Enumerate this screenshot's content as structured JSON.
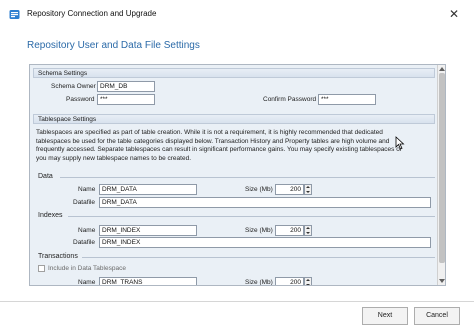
{
  "window": {
    "title": "Repository Connection and Upgrade",
    "close_glyph": "✕"
  },
  "heading": "Repository User and Data File Settings",
  "schema": {
    "section_title": "Schema Settings",
    "owner_label": "Schema Owner",
    "owner_value": "DRM_DB",
    "password_label": "Password",
    "password_value": "***",
    "confirm_label": "Confirm Password",
    "confirm_value": "***"
  },
  "tablespace": {
    "section_title": "Tablespace Settings",
    "description": "Tablespaces are specified as part of table creation. While it is not a requirement, it is highly recommended that dedicated tablespaces be used for the table categories displayed below. Transaction History and Property tables are high volume and frequently accessed. Separate tablespaces can result in significant performance gains. You may specify existing tablespaces or you may supply new tablespace names to be created."
  },
  "data": {
    "title": "Data",
    "name_label": "Name",
    "name_value": "DRM_DATA",
    "size_label": "Size (Mb)",
    "size_value": "200",
    "datafile_label": "Datafile",
    "datafile_value": "DRM_DATA"
  },
  "indexes": {
    "title": "Indexes",
    "name_label": "Name",
    "name_value": "DRM_INDEX",
    "size_label": "Size (Mb)",
    "size_value": "200",
    "datafile_label": "Datafile",
    "datafile_value": "DRM_INDEX"
  },
  "transactions": {
    "title": "Transactions",
    "include_label": "Include in Data Tablespace",
    "name_label": "Name",
    "name_value": "DRM_TRANS",
    "size_label": "Size (Mb)",
    "size_value": "200"
  },
  "footer": {
    "next_label": "Next",
    "cancel_label": "Cancel"
  },
  "colors": {
    "heading": "#2b6aa8",
    "panel_bg": "#eaf0f6",
    "group_bar": "#d8e2ee"
  },
  "icons": [
    "app-icon",
    "close-icon",
    "spin-up-down-icon",
    "scroll-arrow-icon",
    "mouse-cursor-icon"
  ]
}
